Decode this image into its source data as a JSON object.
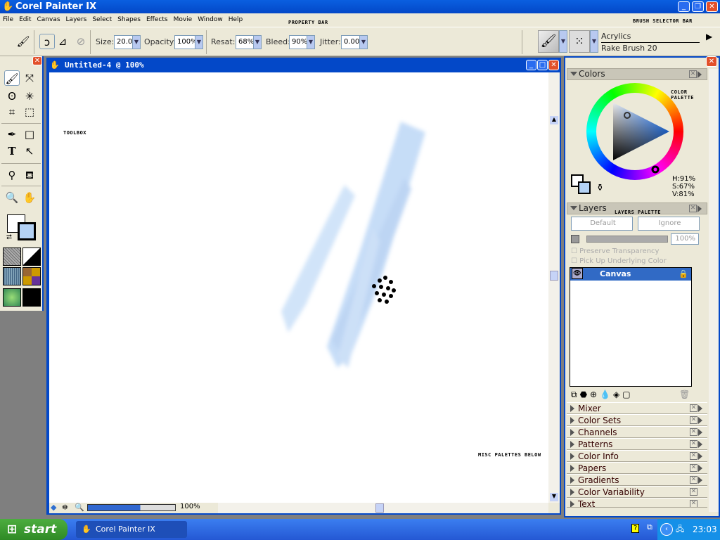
{
  "app": {
    "title": "Corel Painter IX"
  },
  "menu": [
    "File",
    "Edit",
    "Canvas",
    "Layers",
    "Select",
    "Shapes",
    "Effects",
    "Movie",
    "Window",
    "Help"
  ],
  "property_bar": {
    "size_label": "Size:",
    "size": "20.0",
    "opacity_label": "Opacity:",
    "opacity": "100%",
    "resat_label": "Resat:",
    "resat": "68%",
    "bleed_label": "Bleed:",
    "bleed": "90%",
    "jitter_label": "Jitter:",
    "jitter": "0.00"
  },
  "brush_selector": {
    "category": "Acrylics",
    "variant": "Rake Brush 20"
  },
  "annotations": {
    "property_bar": "PROPERTY BAR",
    "brush_selector_bar": "BRUSH SELECTOR BAR",
    "toolbox": "TOOLBOX",
    "color_palette": "COLOR PALETTE",
    "layers_palette": "LAYERS PALETTE",
    "misc": "MISC PALETTES BELOW"
  },
  "document": {
    "title": "Untitled-4 @ 100%",
    "zoom": "100%"
  },
  "colors": {
    "title": "Colors",
    "h": "H:91%",
    "s": "S:67%",
    "v": "V:81%",
    "main_color": "#ffffff",
    "additional_color": "#b4d2f5"
  },
  "layers": {
    "title": "Layers",
    "composite_method": "Default",
    "composite_depth": "Ignore",
    "opacity": "100%",
    "preserve_transparency": "Preserve Transparency",
    "pick_up_color": "Pick Up Underlying Color",
    "items": [
      {
        "name": "Canvas",
        "selected": true
      }
    ]
  },
  "palettes": [
    "Mixer",
    "Color Sets",
    "Channels",
    "Patterns",
    "Color Info",
    "Papers",
    "Gradients",
    "Color Variability",
    "Text"
  ],
  "taskbar": {
    "start": "start",
    "task": "Corel Painter IX",
    "clock": "23:03"
  }
}
